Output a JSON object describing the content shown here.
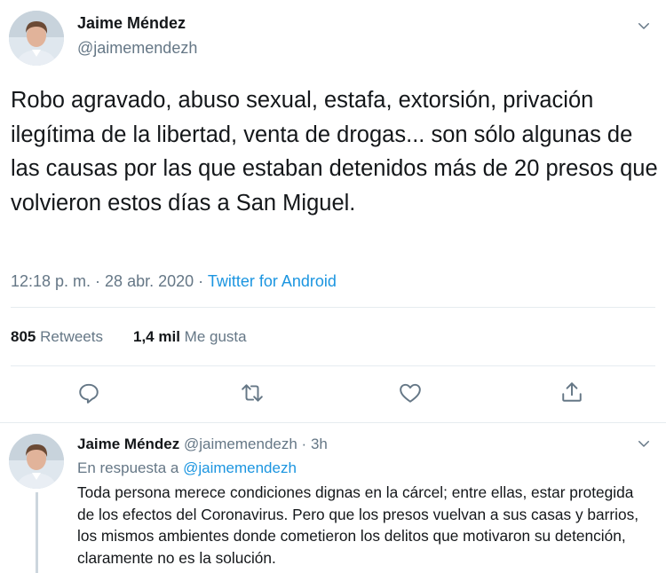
{
  "main_tweet": {
    "author_name": "Jaime Méndez",
    "author_handle": "@jaimemendezh",
    "text": "Robo agravado, abuso sexual, estafa, extorsión, privación ilegítima de la libertad, venta de drogas... son sólo algunas de las causas por las que estaban detenidos más de 20 presos que volvieron estos días a San Miguel.",
    "timestamp": "12:18 p. m. · 28 abr. 2020",
    "separator": " · ",
    "source": "Twitter for Android",
    "retweets_count": "805",
    "retweets_label": "Retweets",
    "likes_count": "1,4 mil",
    "likes_label": "Me gusta"
  },
  "reply_tweet": {
    "author_name": "Jaime Méndez",
    "author_handle": "@jaimemendezh",
    "dot": " · ",
    "time": "3h",
    "in_reply_prefix": "En respuesta a ",
    "in_reply_mention": "@jaimemendezh",
    "text": "Toda persona merece condiciones dignas en la cárcel; entre ellas, estar protegida de los efectos del Coronavirus. Pero que los presos vuelvan a sus casas y barrios, los mismos ambientes donde cometieron los delitos que motivaron su detención, claramente no es la solución."
  },
  "icons": {
    "reply": "reply-icon",
    "retweet": "retweet-icon",
    "like": "heart-icon",
    "share": "share-icon",
    "menu": "chevron-down-icon"
  },
  "colors": {
    "link": "#1b95e0",
    "secondary_text": "#657786",
    "divider": "#e6ecf0"
  }
}
